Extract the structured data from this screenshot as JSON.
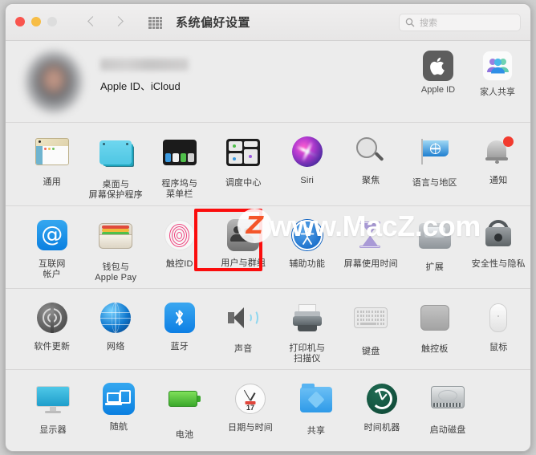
{
  "window": {
    "title": "系统偏好设置",
    "traffic_lights": [
      "close",
      "minimize",
      "zoom"
    ],
    "nav": {
      "back": "‹",
      "forward": "›"
    },
    "grid_icon": "grid-apps-icon"
  },
  "search": {
    "placeholder": "搜索",
    "value": "",
    "icon": "search-icon"
  },
  "account": {
    "name": "",
    "subtitle": "Apple ID、iCloud",
    "avatar": "user-avatar-blurred",
    "tiles": [
      {
        "label": "Apple ID",
        "icon": "apple-logo-icon"
      },
      {
        "label": "家人共享",
        "icon": "family-sharing-icon"
      }
    ]
  },
  "watermark": {
    "badge": "Z",
    "text": "www.MacZ.com"
  },
  "highlight": {
    "target": "用户与群组",
    "color": "#fb0d0d"
  },
  "sections": [
    {
      "id": "section-personal",
      "items": [
        {
          "label": "通用",
          "icon": "general-icon"
        },
        {
          "label": "桌面与\n屏幕保护程序",
          "icon": "desktop-screensaver-icon"
        },
        {
          "label": "程序坞与\n菜单栏",
          "icon": "dock-menubar-icon"
        },
        {
          "label": "调度中心",
          "icon": "mission-control-icon"
        },
        {
          "label": "Siri",
          "icon": "siri-icon"
        },
        {
          "label": "聚焦",
          "icon": "spotlight-icon"
        },
        {
          "label": "语言与地区",
          "icon": "language-region-icon"
        },
        {
          "label": "通知",
          "icon": "notifications-icon"
        }
      ]
    },
    {
      "id": "section-accounts",
      "items": [
        {
          "label": "互联网\n帐户",
          "icon": "internet-accounts-icon"
        },
        {
          "label": "钱包与\nApple Pay",
          "icon": "wallet-applepay-icon"
        },
        {
          "label": "触控ID",
          "icon": "touch-id-icon"
        },
        {
          "label": "用户与群组",
          "icon": "users-groups-icon"
        },
        {
          "label": "辅助功能",
          "icon": "accessibility-icon"
        },
        {
          "label": "屏幕使用时间",
          "icon": "screen-time-icon"
        },
        {
          "label": "扩展",
          "icon": "extensions-icon"
        },
        {
          "label": "安全性与隐私",
          "icon": "security-privacy-icon"
        }
      ]
    },
    {
      "id": "section-hardware",
      "items": [
        {
          "label": "软件更新",
          "icon": "software-update-icon"
        },
        {
          "label": "网络",
          "icon": "network-icon"
        },
        {
          "label": "蓝牙",
          "icon": "bluetooth-icon"
        },
        {
          "label": "声音",
          "icon": "sound-icon"
        },
        {
          "label": "打印机与\n扫描仪",
          "icon": "printers-scanners-icon"
        },
        {
          "label": "键盘",
          "icon": "keyboard-icon"
        },
        {
          "label": "触控板",
          "icon": "trackpad-icon"
        },
        {
          "label": "鼠标",
          "icon": "mouse-icon"
        }
      ]
    },
    {
      "id": "section-system",
      "items": [
        {
          "label": "显示器",
          "icon": "displays-icon"
        },
        {
          "label": "随航",
          "icon": "sidecar-icon"
        },
        {
          "label": "电池",
          "icon": "battery-icon"
        },
        {
          "label": "日期与时间",
          "icon": "date-time-icon"
        },
        {
          "label": "共享",
          "icon": "sharing-icon"
        },
        {
          "label": "时间机器",
          "icon": "time-machine-icon"
        },
        {
          "label": "启动磁盘",
          "icon": "startup-disk-icon"
        }
      ]
    }
  ]
}
